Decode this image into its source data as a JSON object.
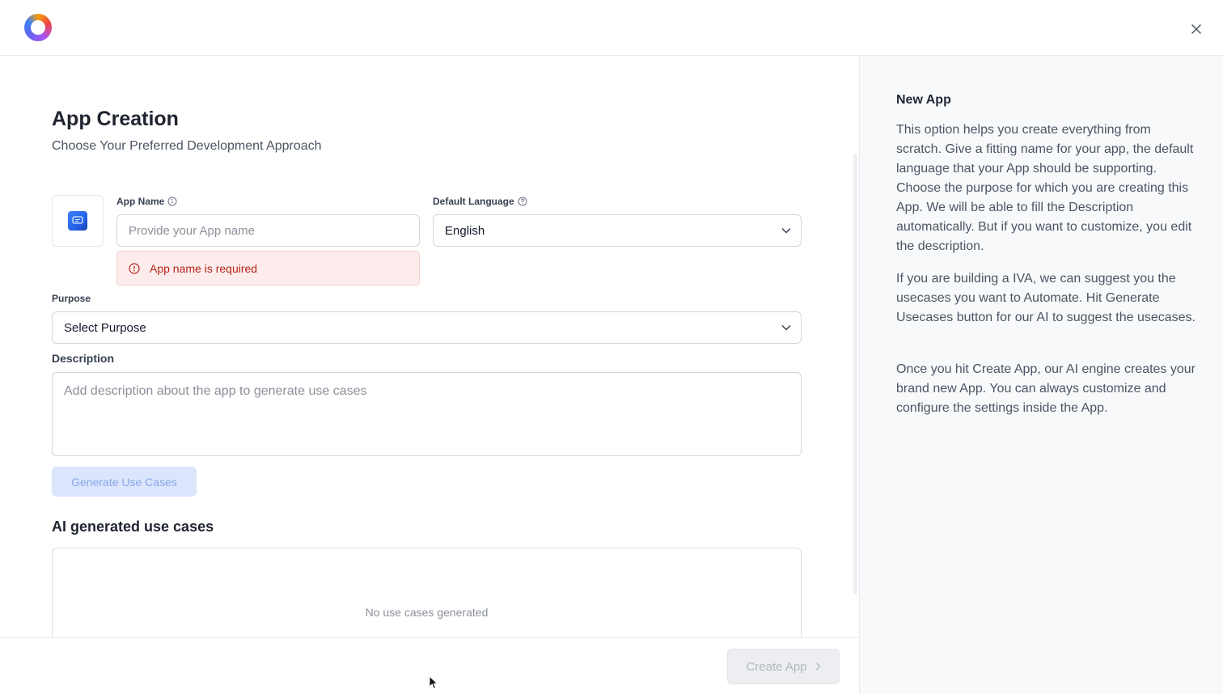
{
  "header": {
    "close_label": "×"
  },
  "form": {
    "title": "App Creation",
    "subtitle": "Choose Your Preferred Development Approach",
    "app_name": {
      "label": "App Name",
      "placeholder": "Provide your App name",
      "value": "",
      "error": "App name is required"
    },
    "language": {
      "label": "Default Language",
      "value": "English"
    },
    "purpose": {
      "label": "Purpose",
      "value": "Select Purpose"
    },
    "description": {
      "label": "Description",
      "placeholder": "Add description about the app to generate use cases",
      "value": ""
    },
    "generate_label": "Generate Use Cases",
    "usecases": {
      "title": "AI generated use cases",
      "empty": "No use cases generated"
    }
  },
  "footer": {
    "create_label": "Create App"
  },
  "side": {
    "title": "New App",
    "paragraphs": [
      "This option helps you create everything from scratch. Give a fitting name for your app, the default language that your App should be supporting. Choose the purpose for which you are creating this App. We will be able to fill the Description automatically. But if you want to customize, you edit the description.",
      "If you are building a IVA, we can suggest you the usecases you want to Automate. Hit Generate Usecases button for our AI to suggest the usecases.",
      "Once you hit Create App, our AI engine creates your brand new App. You can always customize and configure the settings inside the App."
    ]
  },
  "colors": {
    "accent": "#2563eb",
    "error": "#b42318",
    "error_bg": "#fdecec"
  },
  "icons": [
    "logo-icon",
    "close-icon",
    "chat-icon",
    "info-icon",
    "help-icon",
    "alert-icon",
    "chevron-down-icon",
    "chevron-right-icon",
    "cursor-icon"
  ]
}
